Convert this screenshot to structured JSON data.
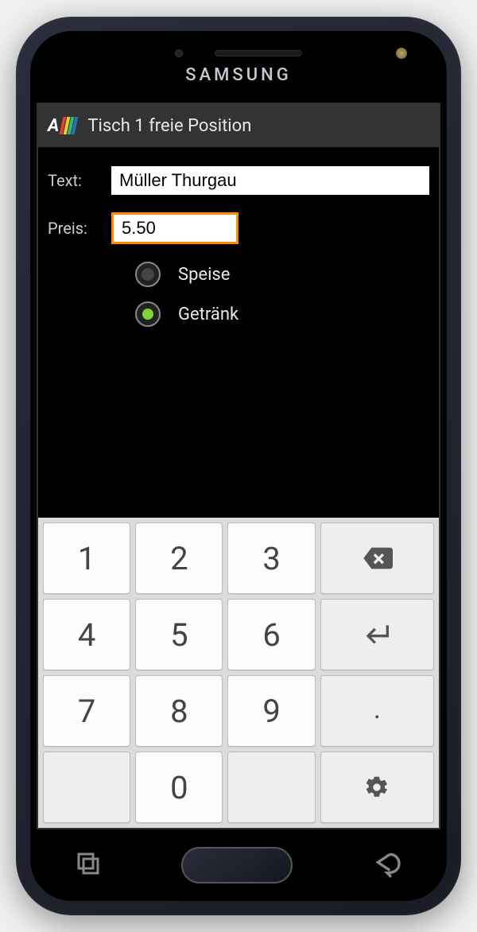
{
  "brand": "SAMSUNG",
  "appbar": {
    "title": "Tisch 1 freie Position"
  },
  "form": {
    "text_label": "Text:",
    "text_value": "Müller Thurgau",
    "price_label": "Preis:",
    "price_value": "5.50",
    "radio_speise": "Speise",
    "radio_getraenk": "Getränk",
    "selected_radio": "getraenk"
  },
  "keypad": {
    "k1": "1",
    "k2": "2",
    "k3": "3",
    "k4": "4",
    "k5": "5",
    "k6": "6",
    "k7": "7",
    "k8": "8",
    "k9": "9",
    "k0": "0",
    "dot": "."
  }
}
